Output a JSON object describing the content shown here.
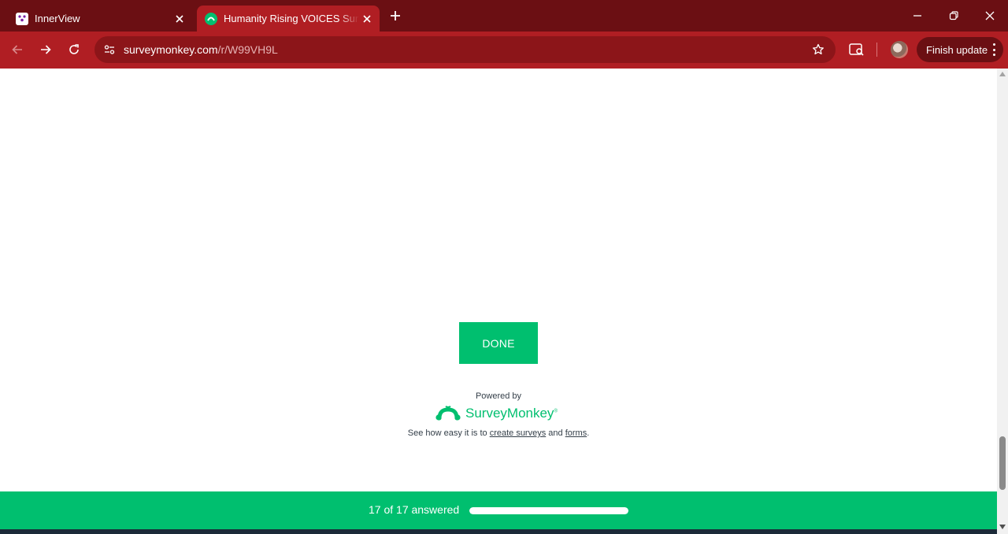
{
  "browser": {
    "tabs": [
      {
        "title": "InnerView",
        "active": false,
        "favicon": "innerview-icon"
      },
      {
        "title": "Humanity Rising VOICES Survey",
        "active": true,
        "favicon": "surveymonkey-icon"
      }
    ],
    "address_bar": {
      "domain": "surveymonkey.com",
      "path": "/r/W99VH9L"
    },
    "finish_update_label": "Finish update",
    "colors": {
      "tabstrip": "#6b0f13",
      "toolbar": "#b01e23",
      "omnibox": "#8c1519"
    }
  },
  "page": {
    "done_label": "DONE",
    "powered_by": "Powered by",
    "brand_name": "SurveyMonkey",
    "brand_mark": "®",
    "footer": {
      "prefix": "See how easy it is to ",
      "link1": "create surveys",
      "middle": " and ",
      "link2": "forms",
      "suffix": "."
    },
    "progress": {
      "text": "17 of 17 answered",
      "answered": 17,
      "total": 17,
      "fraction": 1.0
    },
    "colors": {
      "accent": "#00bf6f",
      "text": "#333e48"
    }
  }
}
